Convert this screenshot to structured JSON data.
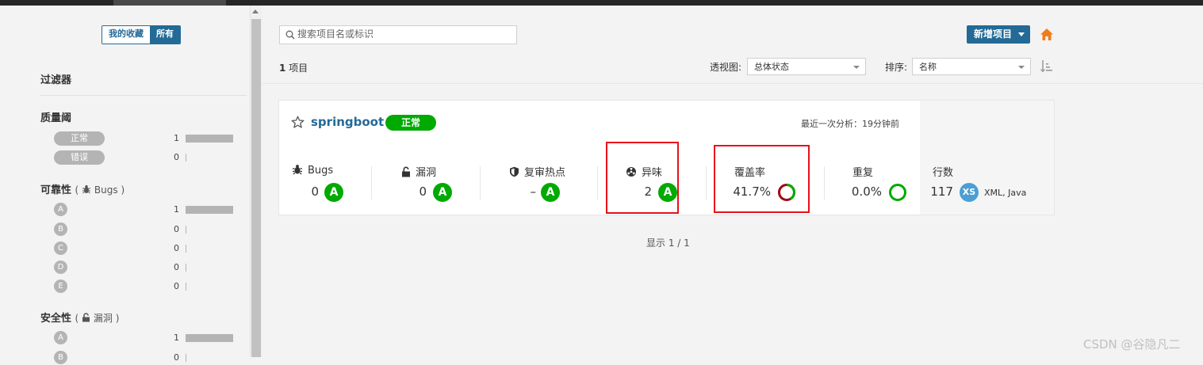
{
  "sidebar": {
    "favorites_label": "我的收藏",
    "all_label": "所有",
    "filters_title": "过滤器",
    "quality_gate": {
      "title": "质量阈",
      "items": [
        {
          "label": "正常",
          "count": "1",
          "fraction": 1
        },
        {
          "label": "错误",
          "count": "0",
          "fraction": 0
        }
      ]
    },
    "reliability": {
      "title": "可靠性",
      "open_paren": "(",
      "sub_label": "Bugs",
      "close_paren": ")",
      "items": [
        {
          "label": "A",
          "count": "1",
          "fraction": 1
        },
        {
          "label": "B",
          "count": "0",
          "fraction": 0
        },
        {
          "label": "C",
          "count": "0",
          "fraction": 0
        },
        {
          "label": "D",
          "count": "0",
          "fraction": 0
        },
        {
          "label": "E",
          "count": "0",
          "fraction": 0
        }
      ]
    },
    "security": {
      "title": "安全性",
      "open_paren": "(",
      "sub_label": "漏洞",
      "close_paren": ")",
      "items": [
        {
          "label": "A",
          "count": "1",
          "fraction": 1
        },
        {
          "label": "B",
          "count": "0",
          "fraction": 0
        }
      ]
    }
  },
  "toolbar": {
    "search_placeholder": "搜索项目名或标识",
    "new_project_label": "新增项目",
    "project_count": "1",
    "project_count_suffix": " 项目",
    "perspective_label": "透视图:",
    "perspective_value": "总体状态",
    "sort_label": "排序:",
    "sort_value": "名称"
  },
  "project": {
    "name": "springboot",
    "gate_status": "正常",
    "last_analysis": "最近一次分析：19分钟前",
    "metrics": {
      "bugs": {
        "label": "Bugs",
        "value": "0",
        "rating": "A"
      },
      "vulnerabilities": {
        "label": "漏洞",
        "value": "0",
        "rating": "A"
      },
      "hotspots": {
        "label": "复审热点",
        "value": "–",
        "rating": "A"
      },
      "code_smells": {
        "label": "异味",
        "value": "2",
        "rating": "A"
      },
      "coverage": {
        "label": "覆盖率",
        "value": "41.7%",
        "percent": 41.7
      },
      "duplications": {
        "label": "重复",
        "value": "0.0%",
        "percent": 0.0
      },
      "lines": {
        "label": "行数",
        "value": "117",
        "size": "XS",
        "languages": "XML, Java"
      }
    }
  },
  "pager_text": "显示 1 / 1",
  "watermark": "CSDN @谷隐凡二",
  "colors": {
    "accent": "#236a97",
    "rating_a": "#00aa00",
    "coverage_covered": "#00aa00",
    "coverage_uncovered": "#a5000c",
    "highlight_box": "#e8101a",
    "size_badge": "#4b9fd5"
  }
}
